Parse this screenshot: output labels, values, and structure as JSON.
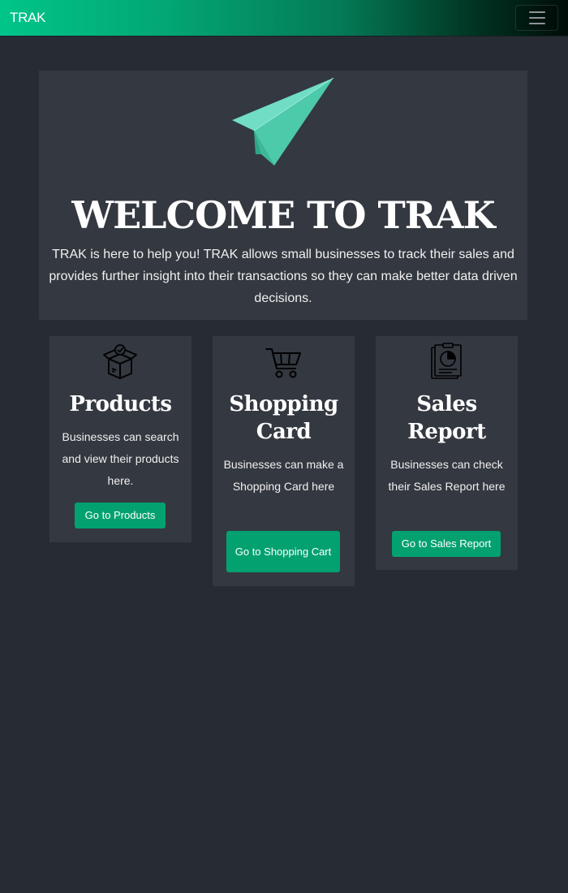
{
  "navbar": {
    "brand": "TRAK",
    "toggle_icon": "hamburger-menu-icon"
  },
  "hero": {
    "icon": "paper-plane-icon",
    "title": "WELCOME TO TRAK",
    "text": "TRAK is here to help you! TRAK allows small businesses to track their sales and provides further insight into their transactions so they can make better data driven decisions."
  },
  "cards": [
    {
      "icon": "box-icon",
      "title": "Products",
      "text": "Businesses can search and view their products here.",
      "button": "Go to Products"
    },
    {
      "icon": "shopping-cart-icon",
      "title": "Shopping Card",
      "text": "Businesses can make a Shopping Card here",
      "button": "Go to Shopping Cart"
    },
    {
      "icon": "sales-report-icon",
      "title": "Sales Report",
      "text": "Businesses can check their Sales Report here",
      "button": "Go to Sales Report"
    }
  ],
  "colors": {
    "accent": "#04a170",
    "background": "#272b33",
    "panel": "#343840",
    "plane": "#5fd6b9"
  }
}
